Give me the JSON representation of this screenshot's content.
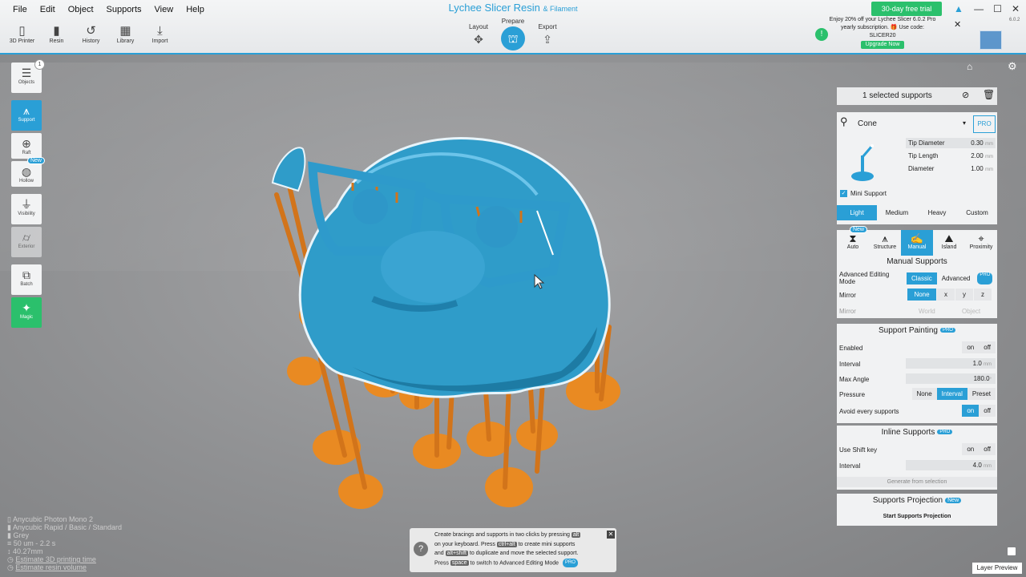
{
  "menu": [
    "File",
    "Edit",
    "Object",
    "Supports",
    "View",
    "Help"
  ],
  "tools": [
    {
      "icon": "printer-icon",
      "glyph": "▯",
      "label": "3D Printer"
    },
    {
      "icon": "resin-icon",
      "glyph": "▮",
      "label": "Resin"
    },
    {
      "icon": "history-icon",
      "glyph": "↺",
      "label": "History"
    },
    {
      "icon": "library-icon",
      "glyph": "▦",
      "label": "Library"
    },
    {
      "icon": "import-icon",
      "glyph": "⤓",
      "label": "Import"
    }
  ],
  "title": {
    "main": "Lychee Slicer Resin",
    "sub": "& Filament"
  },
  "modes": {
    "layout": "Layout",
    "prepare": "Prepare",
    "export": "Export"
  },
  "promo": {
    "trial": "30-day free trial",
    "line1": "Enjoy 20% off your Lychee Slicer 6.0.2 Pro",
    "line2": "yearly subscription. 🎁 Use code:",
    "code": "SLICER20",
    "upgrade": "Upgrade Now",
    "version": "6.0.2"
  },
  "leftbar": {
    "objects": "Objects",
    "objects_count": "1",
    "support": "Support",
    "raft": "Raft",
    "hollow": "Hollow",
    "new": "New",
    "visibility": "Visibility",
    "exterior": "Exterior",
    "batch": "Batch",
    "magic": "Magic"
  },
  "panel": {
    "selected": "1 selected supports",
    "shape": "Cone",
    "pro": "PRO",
    "tip_diameter_label": "Tip Diameter",
    "tip_diameter": "0.30",
    "tip_length_label": "Tip Length",
    "tip_length": "2.00",
    "diameter_label": "Diameter",
    "diameter": "1.00",
    "unit": "mm",
    "mini": "Mini Support",
    "presets": [
      "Light",
      "Medium",
      "Heavy",
      "Custom"
    ],
    "modes": [
      {
        "label": "Auto",
        "new": true
      },
      {
        "label": "Structure"
      },
      {
        "label": "Manual",
        "active": true
      },
      {
        "label": "Island"
      },
      {
        "label": "Proximity"
      }
    ],
    "manual_title": "Manual Supports",
    "adv_mode_label": "Advanced Editing Mode",
    "classic": "Classic",
    "advanced": "Advanced",
    "mirror_label": "Mirror",
    "mirror_opts": [
      "None",
      "x",
      "y",
      "z"
    ],
    "mirror2_label": "Mirror",
    "world": "World",
    "object": "Object",
    "painting_title": "Support Painting",
    "enabled_label": "Enabled",
    "on": "on",
    "off": "off",
    "interval_label": "Interval",
    "interval": "1.0",
    "max_angle_label": "Max Angle",
    "max_angle": "180.0",
    "deg": "°",
    "pressure_label": "Pressure",
    "pressure_opts": [
      "None",
      "Interval",
      "Preset"
    ],
    "avoid_label": "Avoid every supports",
    "inline_title": "Inline Supports",
    "shift_label": "Use Shift key",
    "interval2_label": "Interval",
    "interval2": "4.0",
    "generate": "Generate from selection",
    "projection_title": "Supports Projection",
    "new": "New",
    "start_projection": "Start Supports Projection"
  },
  "hint": {
    "l1a": "Create bracings and supports in two clicks by pressing",
    "k1": "alt",
    "l2a": "on your keyboard. Press",
    "k2": "ctrl+alt",
    "l2b": "to create mini supports",
    "l3a": "and",
    "k3": "alt+shift",
    "l3b": "to duplicate and move the selected support.",
    "l4a": "Press",
    "k4": "space",
    "l4b": "to switch to Advanced Editing Mode",
    "pro": "PRO"
  },
  "info": {
    "printer": "Anycubic Photon Mono 2",
    "resin": "Anycubic Rapid / Basic / Standard",
    "color": "Grey",
    "layer": "50 um - 2.2 s",
    "height": "40.27mm",
    "est_time": "Estimate 3D printing time",
    "est_volume": "Estimate resin volume"
  },
  "layer_preview": "Layer Preview",
  "colors": {
    "accent": "#2a9fd6",
    "model": "#2f9cc9",
    "support": "#e98a22",
    "green": "#2bc06c"
  }
}
